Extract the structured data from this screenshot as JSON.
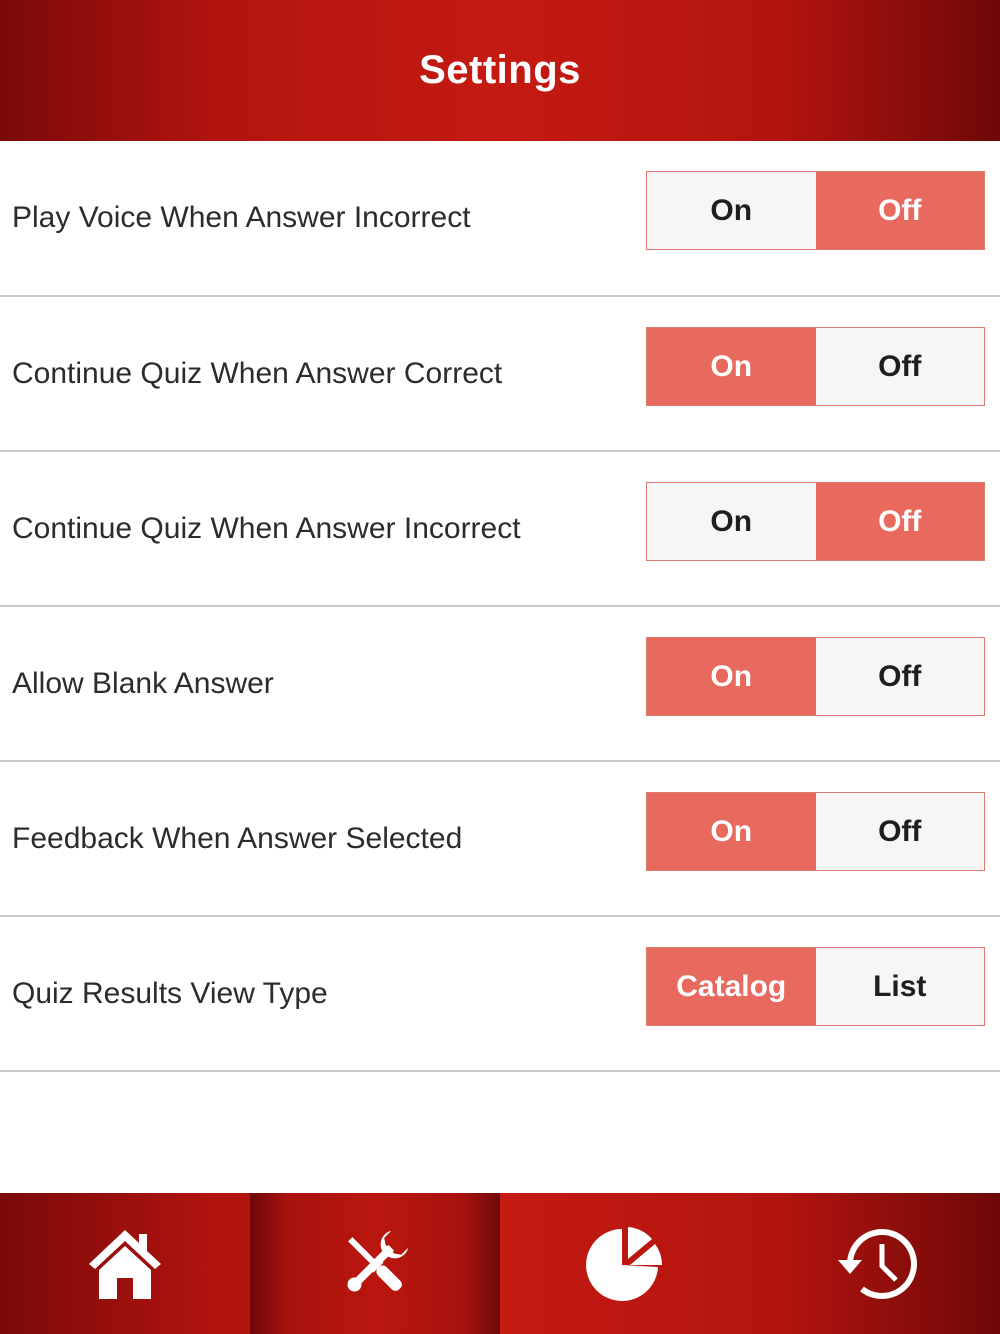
{
  "header": {
    "title": "Settings"
  },
  "settings": [
    {
      "label": "Play Voice When Answer Incorrect",
      "options": [
        "On",
        "Off"
      ],
      "selected": "Off"
    },
    {
      "label": "Continue Quiz When Answer Correct",
      "options": [
        "On",
        "Off"
      ],
      "selected": "On"
    },
    {
      "label": "Continue Quiz When Answer Incorrect",
      "options": [
        "On",
        "Off"
      ],
      "selected": "Off"
    },
    {
      "label": "Allow Blank Answer",
      "options": [
        "On",
        "Off"
      ],
      "selected": "On"
    },
    {
      "label": "Feedback When Answer Selected",
      "options": [
        "On",
        "Off"
      ],
      "selected": "On"
    },
    {
      "label": "Quiz Results View Type",
      "options": [
        "Catalog",
        "List"
      ],
      "selected": "Catalog"
    }
  ],
  "tabbar": {
    "tabs": [
      {
        "icon": "home-icon"
      },
      {
        "icon": "tools-icon",
        "selected": true
      },
      {
        "icon": "pie-chart-icon"
      },
      {
        "icon": "history-icon"
      }
    ]
  },
  "colors": {
    "brand_red": "#c41a12",
    "active_segment": "#e8695d",
    "inactive_segment": "#f6f6f6"
  }
}
